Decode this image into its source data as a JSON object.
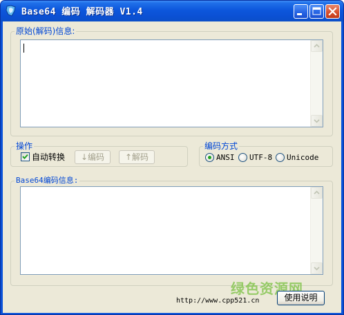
{
  "window": {
    "title": "Base64 编码 解码器 V1.4",
    "icons": {
      "app": "app-icon",
      "minimize": "minimize-icon",
      "maximize": "maximize-icon",
      "close": "close-icon"
    }
  },
  "source_group": {
    "label": "原始(解码)信息:",
    "text": ""
  },
  "operation_group": {
    "label": "操作",
    "auto_convert_label": "自动转换",
    "auto_convert_checked": true,
    "encode_button": "↓编码",
    "decode_button": "↑解码"
  },
  "encoding_group": {
    "label": "编码方式",
    "options": [
      "ANSI",
      "UTF-8",
      "Unicode"
    ],
    "selected": "ANSI"
  },
  "base64_group": {
    "label": "Base64编码信息:",
    "text": ""
  },
  "footer": {
    "url": "http://www.cpp521.cn",
    "help_button": "使用说明"
  },
  "watermark": "绿色资源网",
  "colors": {
    "titlebar": "#0b50d4",
    "client_bg": "#ece9d8",
    "group_label": "#0046d5",
    "radio_dot": "#21a121",
    "watermark": "#7ac142"
  }
}
